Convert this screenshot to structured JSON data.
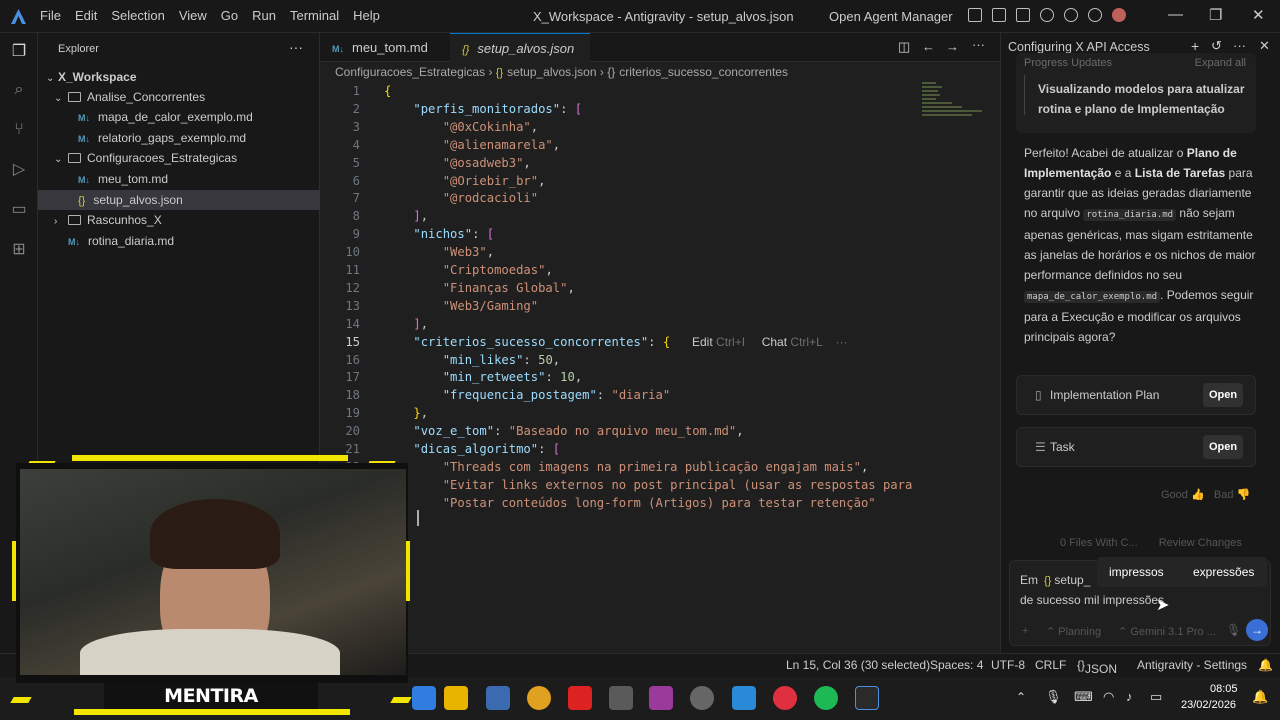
{
  "titlebar": {
    "menu": [
      "File",
      "Edit",
      "Selection",
      "View",
      "Go",
      "Run",
      "Terminal",
      "Help"
    ],
    "window_title": "X_Workspace - Antigravity - setup_alvos.json",
    "agent_manager": "Open Agent Manager"
  },
  "explorer": {
    "header": "Explorer",
    "root": "X_Workspace",
    "items": [
      {
        "label": "Analise_Concorrentes",
        "kind": "folder"
      },
      {
        "label": "mapa_de_calor_exemplo.md",
        "kind": "md"
      },
      {
        "label": "relatorio_gaps_exemplo.md",
        "kind": "md"
      },
      {
        "label": "Configuracoes_Estrategicas",
        "kind": "folder"
      },
      {
        "label": "meu_tom.md",
        "kind": "md"
      },
      {
        "label": "setup_alvos.json",
        "kind": "json"
      },
      {
        "label": "Rascunhos_X",
        "kind": "folder"
      },
      {
        "label": "rotina_diaria.md",
        "kind": "md"
      }
    ]
  },
  "tabs": [
    {
      "label": "meu_tom.md"
    },
    {
      "label": "setup_alvos.json"
    }
  ],
  "breadcrumb": [
    "Configuracoes_Estrategicas",
    "setup_alvos.json",
    "criterios_sucesso_concorrentes"
  ],
  "editor": {
    "lines": [
      "{",
      "    \"perfis_monitorados\": [",
      "        \"@0xCokinha\",",
      "        \"@alienamarela\",",
      "        \"@osadweb3\",",
      "        \"@Oriebir_br\",",
      "        \"@rodcacioli\"",
      "    ],",
      "    \"nichos\": [",
      "        \"Web3\",",
      "        \"Criptomoedas\",",
      "        \"Finanças Global\",",
      "        \"Web3/Gaming\"",
      "    ],",
      "    \"criterios_sucesso_concorrentes\": {",
      "        \"min_likes\": 50,",
      "        \"min_retweets\": 10,",
      "        \"frequencia_postagem\": \"diaria\"",
      "    },",
      "    \"voz_e_tom\": \"Baseado no arquivo meu_tom.md\",",
      "    \"dicas_algoritmo\": [",
      "        \"Threads com imagens na primeira publicação engajam mais\",",
      "        \"Evitar links externos no post principal (usar as respostas para",
      "        \"Postar conteúdos long-form (Artigos) para testar retenção\""
    ],
    "inline_menu": {
      "edit": "Edit",
      "edit_key": "Ctrl+I",
      "chat": "Chat",
      "chat_key": "Ctrl+L",
      "more": "···"
    }
  },
  "agent": {
    "title": "Configuring X API Access",
    "progress_label": "Progress Updates",
    "expand_label": "Expand all",
    "step": "Visualizando modelos para atualizar rotina e plano de Implementação",
    "message_parts": {
      "p1": "Perfeito! Acabei de atualizar o ",
      "b1": "Plano de Implementação",
      "p2": " e a ",
      "b2": "Lista de Tarefas",
      "p3": " para garantir que as ideias geradas diariamente no arquivo ",
      "c1": "rotina_diaria.md",
      "p4": " não sejam apenas genéricas, mas sigam estritamente as janelas de horários e os nichos de maior performance definidos no seu ",
      "c2": "mapa_de_calor_exemplo.md",
      "p5": ". Podemos seguir para a Execução e modificar os arquivos principais agora?"
    },
    "artifacts": [
      {
        "label": "Implementation Plan",
        "button": "Open"
      },
      {
        "label": "Task",
        "button": "Open"
      }
    ],
    "feedback": {
      "good": "Good",
      "bad": "Bad"
    },
    "files_changed": "0 Files With C...",
    "review": "Review Changes",
    "suggestions": [
      "impressos",
      "expressões"
    ],
    "input_prefix": "Em",
    "input_file": "setup_",
    "input_text": "de sucesso mil impressões",
    "mode": "Planning",
    "model": "Gemini 3.1 Pro ..."
  },
  "status": {
    "position": "Ln 15, Col 36 (30 selected)",
    "spaces": "Spaces: 4",
    "encoding": "UTF-8",
    "eol": "CRLF",
    "language": "JSON",
    "settings": "Antigravity - Settings"
  },
  "taskbar": {
    "time": "08:05",
    "date": "23/02/2026"
  },
  "webcam": {
    "caption": "MENTIRA"
  }
}
